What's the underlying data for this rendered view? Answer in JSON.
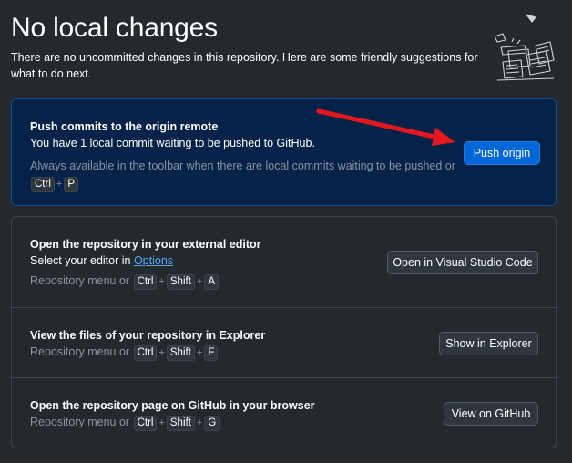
{
  "header": {
    "title": "No local changes",
    "subtitle": "There are no uncommitted changes in this repository. Here are some friendly suggestions for what to do next."
  },
  "push": {
    "heading": "Push commits to the origin remote",
    "description": "You have 1 local commit waiting to be pushed to GitHub.",
    "hint": "Always available in the toolbar when there are local commits waiting to be pushed or",
    "shortcut": [
      "Ctrl",
      "P"
    ],
    "button": "Push origin"
  },
  "suggestions": [
    {
      "heading": "Open the repository in your external editor",
      "line_prefix": "Select your editor in ",
      "link": "Options",
      "hint": "Repository menu or",
      "shortcut": [
        "Ctrl",
        "Shift",
        "A"
      ],
      "button": "Open in Visual Studio Code"
    },
    {
      "heading": "View the files of your repository in Explorer",
      "hint": "Repository menu or",
      "shortcut": [
        "Ctrl",
        "Shift",
        "F"
      ],
      "button": "Show in Explorer"
    },
    {
      "heading": "Open the repository page on GitHub in your browser",
      "hint": "Repository menu or",
      "shortcut": [
        "Ctrl",
        "Shift",
        "G"
      ],
      "button": "View on GitHub"
    }
  ],
  "plus": "+",
  "colors": {
    "background": "#24292e",
    "push_card_bg": "#052249",
    "primary_button": "#0366d6",
    "link": "#58a6ff",
    "annotation_arrow": "#e3171d"
  },
  "icons": [
    "empty-repository-illustration",
    "red-annotation-arrow"
  ]
}
